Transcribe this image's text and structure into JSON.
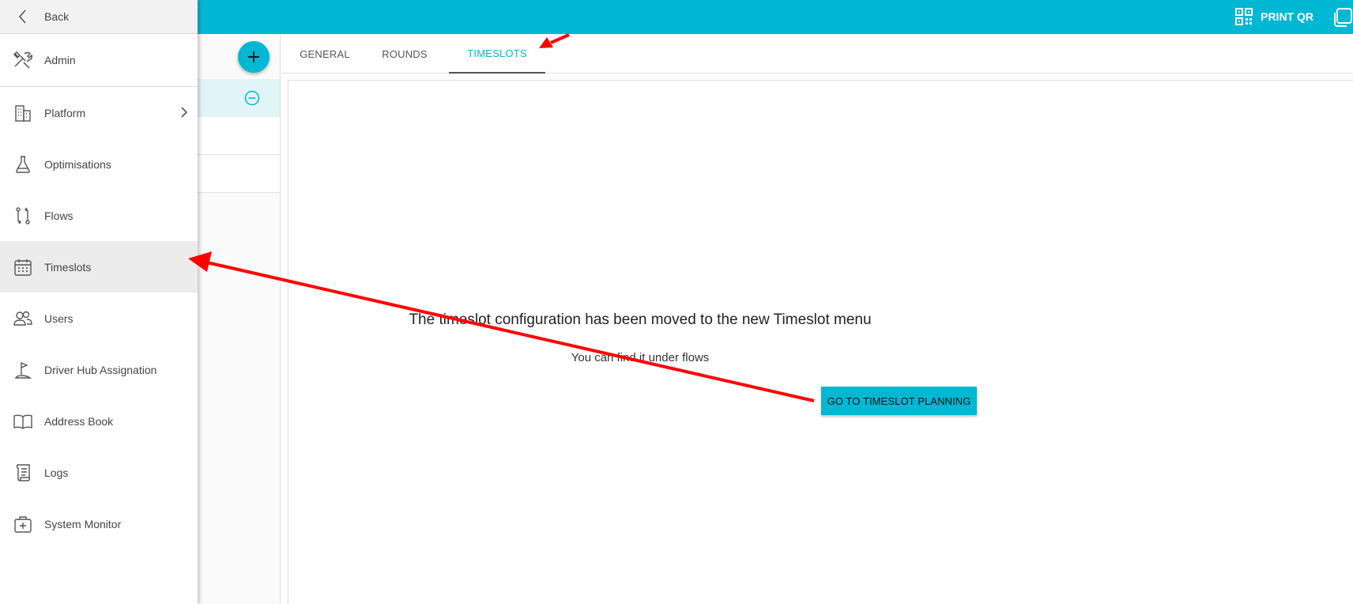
{
  "topbar": {
    "print_qr_label": "PRINT QR",
    "accent_color": "#00b8d4"
  },
  "drawer": {
    "back_label": "Back",
    "admin_label": "Admin",
    "items": [
      {
        "label": "Platform",
        "icon": "building-icon",
        "has_submenu": true
      },
      {
        "label": "Optimisations",
        "icon": "flask-icon"
      },
      {
        "label": "Flows",
        "icon": "flow-icon"
      },
      {
        "label": "Timeslots",
        "icon": "calendar-icon",
        "active": true
      },
      {
        "label": "Users",
        "icon": "users-icon"
      },
      {
        "label": "Driver Hub Assignation",
        "icon": "flag-icon"
      },
      {
        "label": "Address Book",
        "icon": "book-icon"
      },
      {
        "label": "Logs",
        "icon": "scroll-icon"
      },
      {
        "label": "System Monitor",
        "icon": "medical-case-icon"
      }
    ]
  },
  "tabs": [
    {
      "label": "GENERAL"
    },
    {
      "label": "ROUNDS"
    },
    {
      "label": "TIMESLOTS",
      "active": true
    }
  ],
  "main": {
    "title": "The timeslot configuration has been moved to the new Timeslot menu",
    "subtitle": "You can find it under flows",
    "button_label": "GO TO TIMESLOT PLANNING"
  },
  "annotation_color": "#ff0000"
}
